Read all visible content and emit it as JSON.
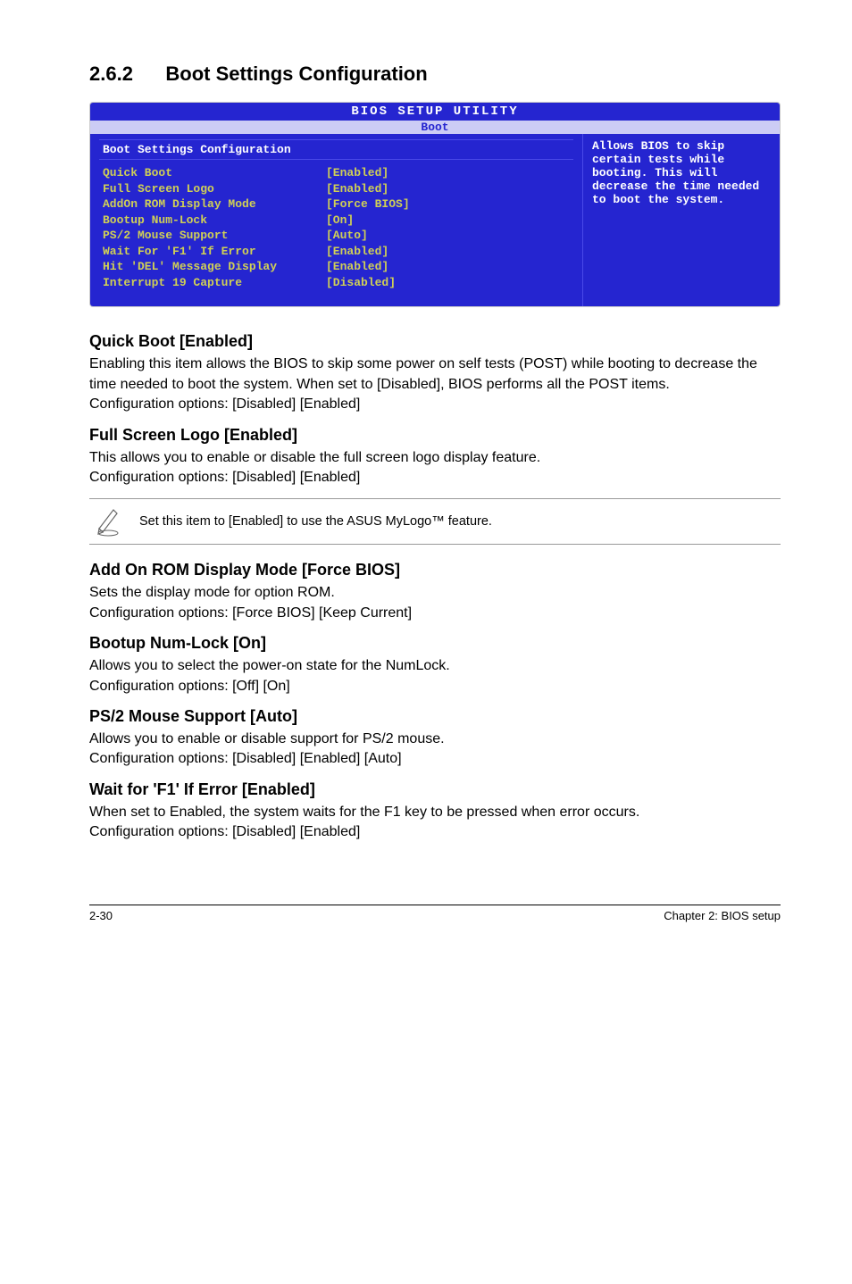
{
  "heading": {
    "number": "2.6.2",
    "title": "Boot Settings Configuration"
  },
  "bios": {
    "header": "BIOS SETUP UTILITY",
    "tab": "Boot",
    "subheader": "Boot Settings Configuration",
    "help": "Allows BIOS to skip certain tests while booting. This will decrease the time needed to boot the system.",
    "rows": [
      {
        "label": "Quick Boot",
        "value": "[Enabled]"
      },
      {
        "label": "Full Screen Logo",
        "value": "[Enabled]"
      },
      {
        "label": "AddOn ROM Display Mode",
        "value": "[Force BIOS]"
      },
      {
        "label": "Bootup Num-Lock",
        "value": "[On]"
      },
      {
        "label": "PS/2 Mouse Support",
        "value": "[Auto]"
      },
      {
        "label": "Wait For 'F1' If Error",
        "value": "[Enabled]"
      },
      {
        "label": "Hit 'DEL' Message Display",
        "value": "[Enabled]"
      },
      {
        "label": "Interrupt 19 Capture",
        "value": "[Disabled]"
      }
    ]
  },
  "sections": {
    "quickboot": {
      "title": "Quick Boot [Enabled]",
      "body": "Enabling this item allows the BIOS to skip some power on self tests (POST) while booting to decrease the time needed to boot the system. When set to [Disabled], BIOS performs all the POST items.",
      "opts": "Configuration options: [Disabled] [Enabled]"
    },
    "fullscreen": {
      "title": "Full Screen Logo [Enabled]",
      "body": "This allows you to enable or disable the full screen logo display feature.",
      "opts": "Configuration options: [Disabled] [Enabled]"
    },
    "note": "Set this item to [Enabled] to use the ASUS MyLogo™ feature.",
    "addon": {
      "title": "Add On ROM Display Mode [Force BIOS]",
      "body": "Sets the display mode for option ROM.",
      "opts": "Configuration options: [Force BIOS] [Keep Current]"
    },
    "numlock": {
      "title": "Bootup Num-Lock [On]",
      "body": "Allows you to select the power-on state for the NumLock.",
      "opts": "Configuration options: [Off] [On]"
    },
    "ps2": {
      "title": "PS/2 Mouse Support [Auto]",
      "body": "Allows you to enable or disable support for PS/2 mouse.",
      "opts": "Configuration options: [Disabled] [Enabled] [Auto]"
    },
    "waitf1": {
      "title": "Wait for 'F1' If Error [Enabled]",
      "body": "When set to Enabled, the system waits for the F1 key to be pressed when error occurs.",
      "opts": "Configuration options: [Disabled] [Enabled]"
    }
  },
  "footer": {
    "left": "2-30",
    "right": "Chapter 2: BIOS setup"
  }
}
